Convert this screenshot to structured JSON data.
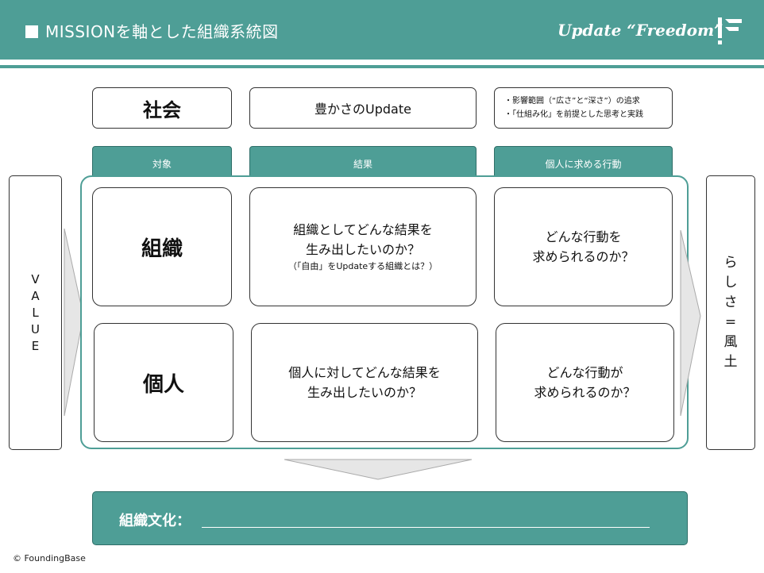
{
  "header": {
    "title": "MISSIONを軸とした組織系統図",
    "tagline": "Update “Freedom”"
  },
  "top_row": {
    "society_label": "社会",
    "update_label": "豊かさのUpdate",
    "notes": [
      "・影響範囲（“広さ”と“深さ”）の追求",
      "・「仕組み化」を前提とした思考と実践"
    ]
  },
  "column_headers": [
    "対象",
    "結果",
    "個人に求める行動"
  ],
  "rows": [
    {
      "target": "組織",
      "result_lines": [
        "組織としてどんな結果を",
        "生み出したいのか？"
      ],
      "result_note": "（「自由」をUpdateする組織とは？）",
      "action_lines": [
        "どんな行動を",
        "求められるのか？"
      ]
    },
    {
      "target": "個人",
      "result_lines": [
        "個人に対してどんな結果を",
        "生み出したいのか？"
      ],
      "action_lines": [
        "どんな行動が",
        "求められるのか？"
      ]
    }
  ],
  "side_left": [
    "V",
    "A",
    "L",
    "U",
    "E"
  ],
  "side_right": [
    "ら",
    "し",
    "さ",
    "=",
    "風",
    "土"
  ],
  "bottom": {
    "label": "組織文化："
  },
  "footer": "© FoundingBase",
  "colors": {
    "teal": "#4e9e96",
    "arrow_fill": "#e6e6e6"
  }
}
